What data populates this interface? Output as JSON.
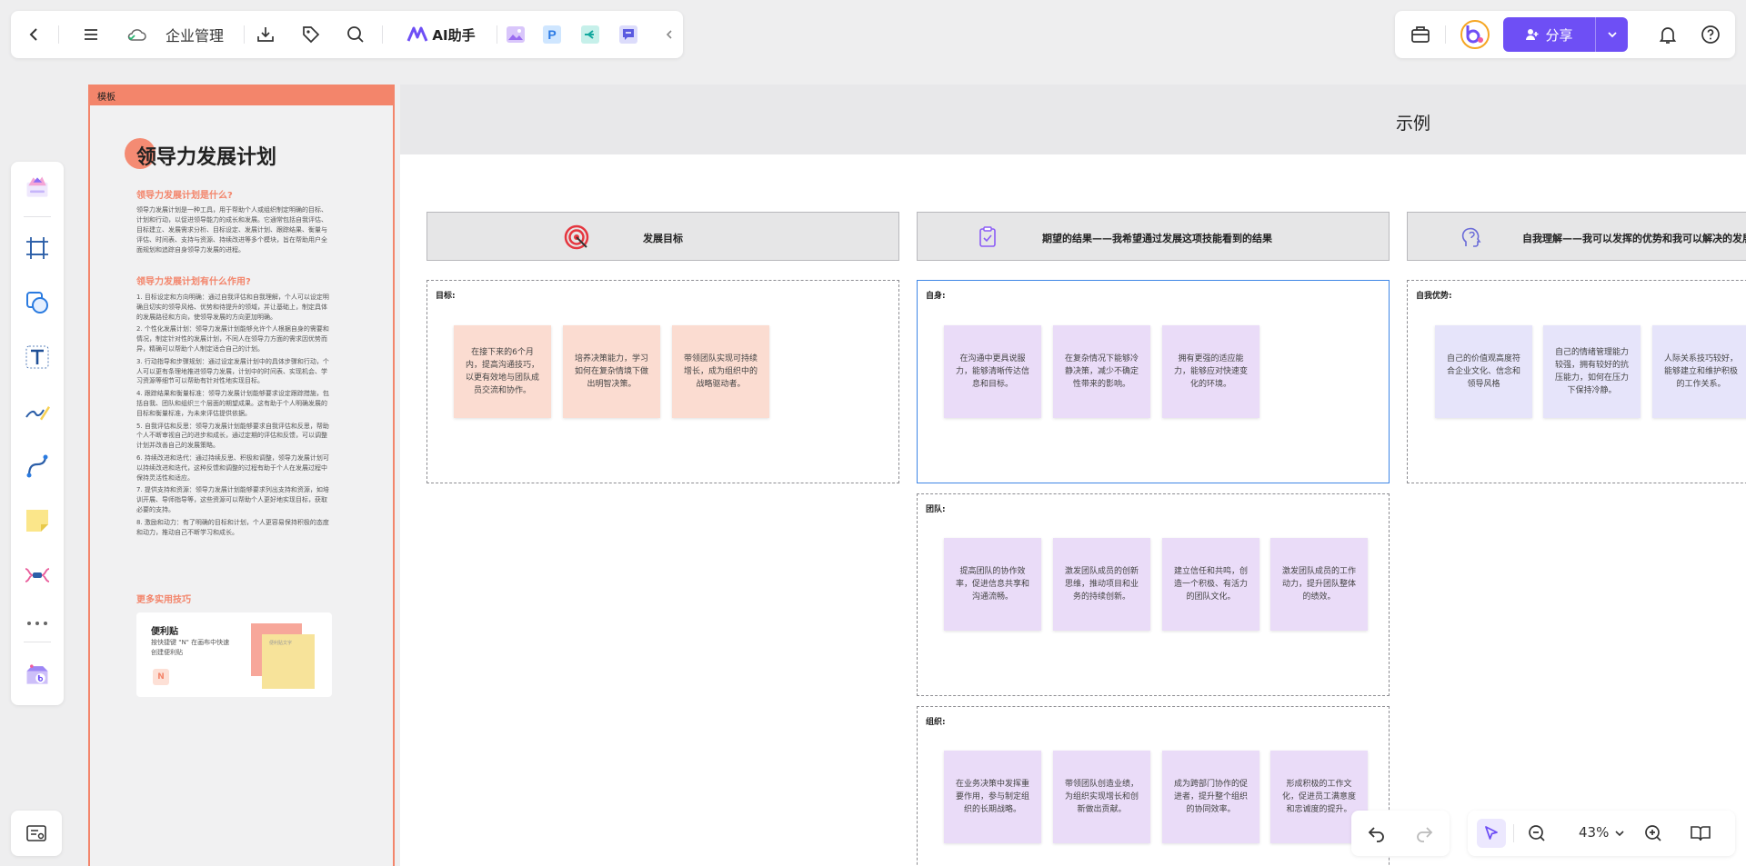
{
  "toolbar": {
    "app_title": "企业管理",
    "ai_label": "AI助手",
    "share_label": "分享"
  },
  "zoom": {
    "value": "43%"
  },
  "template": {
    "tab": "模板",
    "title": "领导力发展计划",
    "q1": "领导力发展计划是什么?",
    "p1": "领导力发展计划是一种工具，用于帮助个人或组织制定明确的目标、计划和行动，以促进领导能力的成长和发展。它通常包括自我评估、目标建立、发展需求分析、目标设定、发展计划、跟踪结果、衡量与评估、时间表、支持与资源、持续改进等多个模块，旨在帮助用户全面规划和追踪自身领导力发展的进程。",
    "q2": "领导力发展计划有什么作用?",
    "items": [
      "1. 目标设定和方向明确：通过自我评估和自我理解，个人可以设定明确且切实的领导风格、优势和待提升的领域，并让基础上，制定具体的发展路径和方向，使领导发展的方向更加明确。",
      "2. 个性化发展计划：领导力发展计划能够允许个人根据自身的需要和情况，制定针对性的发展计划，不同人在领导力方面的需求因优势而异，精确可以帮助个人制定适合自己的计划。",
      "3. 行动指导和步骤规划：通过设定发展计划中的具体步骤和行动，个人可以更有条理地推进领导力发展，计划中的时间表、实现机会、学习资源等细节可以帮助有针对性地实现目标。",
      "4. 跟踪结果和衡量标准：领导力发展计划能够要求设定跟踪措施，包括自我、团队和组织三个层面的期望成果。这有助于个人明确发展的目标和衡量标准，为未来评估提供依据。",
      "5. 自我评估和反思：领导力发展计划能够要求自我评估和反思，帮助个人不断审视自己的进步和成长，通过定期的评估和反馈，可以调整计划并改善自己的发展策略。",
      "6. 持续改进和迭代：通过持续反思、积极和调整，领导力发展计划可以持续改进和迭代，这种反馈和调整的过程有助于个人在发展过程中保持灵活性和适应。",
      "7. 提供支持和资源：领导力发展计划能够要求列出支持和资源，如培训开展、导师指导等，这些资源可以帮助个人更好地实现目标，获取必要的支持。",
      "8. 激励和动力：有了明确的目标和计划，个人更容易保持积极的态度和动力，推动自己不断学习和成长。"
    ],
    "more": "更多实用技巧",
    "tip_title": "便利贴",
    "tip_desc": "按快捷键 \"N\" 在画布中快速创建便利贴",
    "tip_key": "N",
    "tip_sticky_text": "便利贴文字"
  },
  "board": {
    "title": "示例",
    "columns": [
      {
        "title": "发展目标",
        "icon": "target-icon"
      },
      {
        "title": "期望的结果——我希望通过发展这项技能看到的结果",
        "icon": "clipboard-check-icon"
      },
      {
        "title": "自我理解——我可以发挥的优势和我可以解决的发展",
        "icon": "head-icon"
      }
    ],
    "zones": {
      "goal": {
        "label": "目标:",
        "notes": [
          "在接下来的6个月内，提高沟通技巧，以更有效地与团队成员交流和协作。",
          "培养决策能力，学习如何在复杂情境下做出明智决策。",
          "带领团队实现可持续增长，成为组织中的战略驱动者。"
        ]
      },
      "self": {
        "label": "自身:",
        "notes": [
          "在沟通中更具说服力，能够清晰传达信息和目标。",
          "在复杂情况下能够冷静决策，减少不确定性带来的影响。",
          "拥有更强的适应能力，能够应对快速变化的环境。"
        ]
      },
      "team": {
        "label": "团队:",
        "notes": [
          "提高团队的协作效率，促进信息共享和沟通流畅。",
          "激发团队成员的创新思维，推动项目和业务的持续创新。",
          "建立信任和共鸣，创造一个积极、有活力的团队文化。",
          "激发团队成员的工作动力，提升团队整体的绩效。"
        ]
      },
      "org": {
        "label": "组织:",
        "notes": [
          "在业务决策中发挥重要作用，参与制定组织的长期战略。",
          "带领团队创造业绩，为组织实现增长和创新做出贡献。",
          "成为跨部门协作的促进者，提升整个组织的协同效率。",
          "形成积极的工作文化，促进员工满意度和忠诚度的提升。"
        ]
      },
      "strength": {
        "label": "自我优势:",
        "notes": [
          "自己的价值观高度符合企业文化、信念和领导风格",
          "自己的情绪管理能力较强，拥有较好的抗压能力，如何在压力下保持冷静。",
          "人际关系技巧较好，能够建立和维护积极的工作关系。"
        ]
      }
    }
  },
  "colors": {
    "accent": "#6e4ff5",
    "template_orange": "#f3856b",
    "selection_blue": "#3e86e6"
  }
}
